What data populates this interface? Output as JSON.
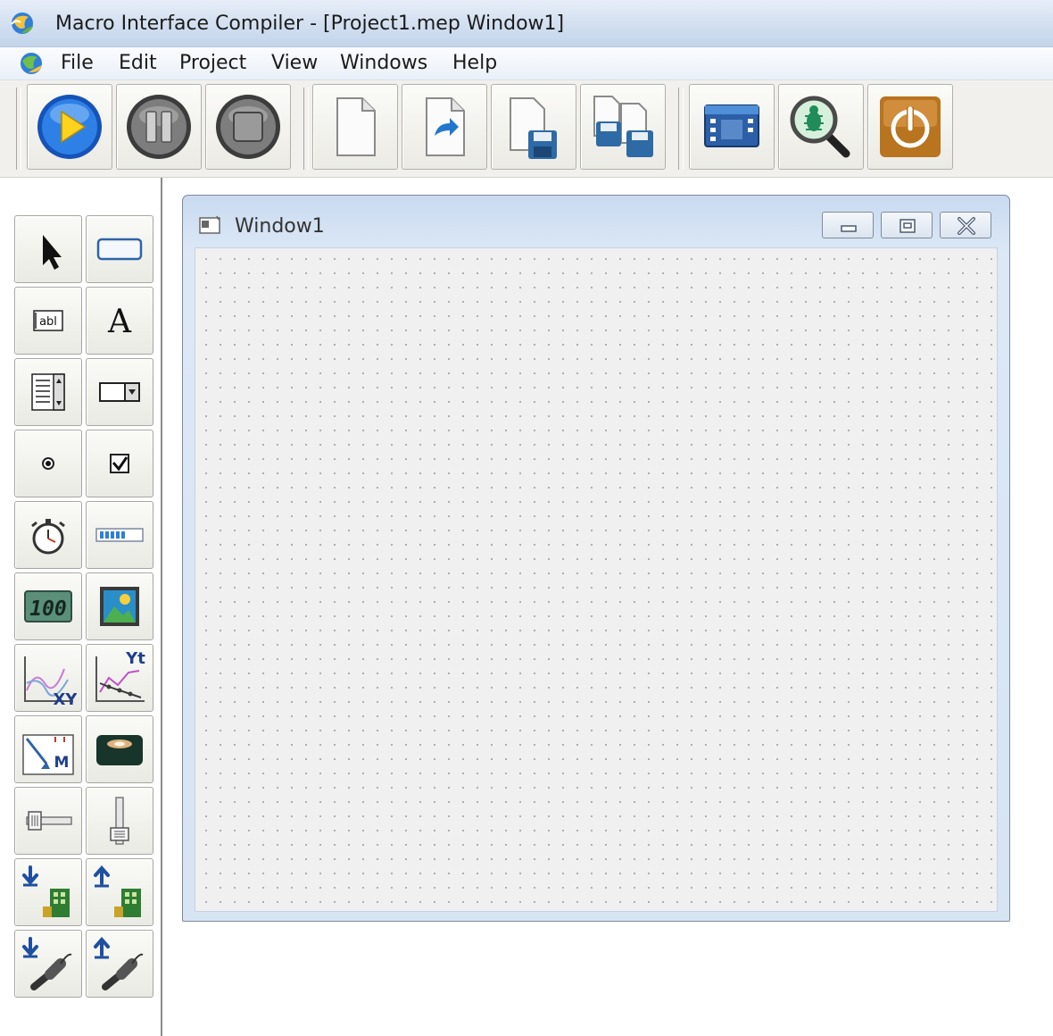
{
  "window": {
    "title": "Macro Interface Compiler - [Project1.mep Window1]"
  },
  "menu": {
    "items": [
      {
        "label": "File"
      },
      {
        "label": "Edit"
      },
      {
        "label": "Project"
      },
      {
        "label": "View"
      },
      {
        "label": "Windows"
      },
      {
        "label": "Help"
      }
    ]
  },
  "toolbar": {
    "buttons": [
      {
        "icon": "play-icon"
      },
      {
        "icon": "pause-icon"
      },
      {
        "icon": "stop-icon"
      },
      {
        "icon": "new-document-icon"
      },
      {
        "icon": "open-document-icon"
      },
      {
        "icon": "save-icon"
      },
      {
        "icon": "save-all-icon"
      },
      {
        "icon": "window-properties-icon"
      },
      {
        "icon": "debug-search-icon"
      },
      {
        "icon": "exit-icon"
      }
    ]
  },
  "palette": {
    "tools": [
      {
        "icon": "pointer-icon"
      },
      {
        "icon": "button-control-icon"
      },
      {
        "icon": "textbox-icon",
        "text": "abl"
      },
      {
        "icon": "label-icon",
        "text": "A"
      },
      {
        "icon": "listbox-icon"
      },
      {
        "icon": "combobox-icon"
      },
      {
        "icon": "radio-button-icon"
      },
      {
        "icon": "checkbox-icon"
      },
      {
        "icon": "timer-icon"
      },
      {
        "icon": "progressbar-icon"
      },
      {
        "icon": "numeric-display-icon",
        "text": "100"
      },
      {
        "icon": "image-icon"
      },
      {
        "icon": "xy-chart-icon",
        "text": "XY"
      },
      {
        "icon": "yt-chart-icon",
        "text": "Yt"
      },
      {
        "icon": "meter-icon",
        "text": "M"
      },
      {
        "icon": "led-icon"
      },
      {
        "icon": "horizontal-slider-icon"
      },
      {
        "icon": "vertical-slider-icon"
      },
      {
        "icon": "plc-read-icon"
      },
      {
        "icon": "plc-write-icon"
      },
      {
        "icon": "usb-read-icon"
      },
      {
        "icon": "usb-write-icon"
      }
    ]
  },
  "design": {
    "form_title": "Window1",
    "colors": {
      "grid_background": "#f0f0f0",
      "titlebar": "#d7e4f4",
      "accent_blue": "#1f6fd6"
    }
  }
}
